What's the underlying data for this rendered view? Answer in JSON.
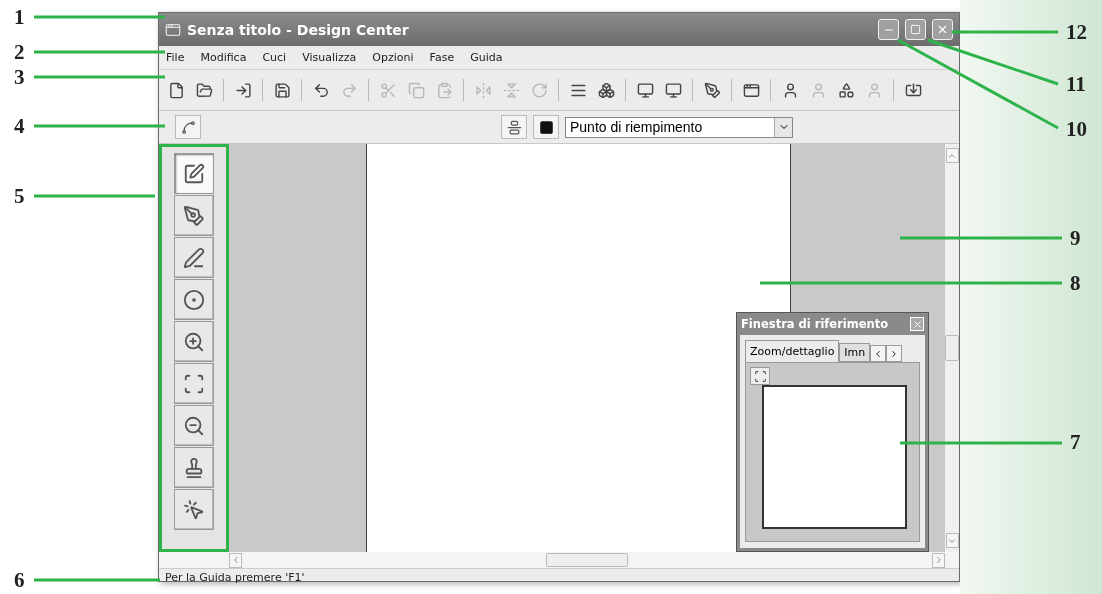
{
  "window": {
    "title": "Senza titolo - Design Center"
  },
  "menu": [
    "File",
    "Modifica",
    "Cuci",
    "Visualizza",
    "Opzioni",
    "Fase",
    "Guida"
  ],
  "toolbar": [
    {
      "disabled": false
    },
    {
      "disabled": false
    },
    {
      "disabled": false
    },
    {
      "disabled": false
    },
    {
      "disabled": false
    },
    {
      "disabled": true
    },
    {
      "disabled": true
    },
    {
      "disabled": true
    },
    {
      "disabled": true
    },
    {
      "disabled": true
    },
    {
      "disabled": true
    },
    {
      "disabled": true
    },
    {
      "disabled": false
    },
    {
      "disabled": false
    },
    {
      "disabled": false
    },
    {
      "disabled": false
    },
    {
      "disabled": false
    },
    {
      "disabled": false
    },
    {
      "disabled": false
    },
    {
      "disabled": true
    },
    {
      "disabled": false
    },
    {
      "disabled": true
    },
    {
      "disabled": false
    }
  ],
  "stitch_bar": {
    "stitch_type": "Punto di riempimento"
  },
  "tools": [
    {
      "selected": true
    },
    {
      "selected": false
    },
    {
      "selected": false
    },
    {
      "selected": false
    },
    {
      "selected": false
    },
    {
      "selected": false
    },
    {
      "selected": false
    },
    {
      "selected": false
    },
    {
      "selected": false
    }
  ],
  "reference_window": {
    "title": "Finestra di riferimento",
    "tabs": [
      {
        "label": "Zoom/dettaglio",
        "selected": true
      },
      {
        "label": "Imn",
        "selected": false
      }
    ]
  },
  "status_bar": "Per la Guida premere 'F1'",
  "callouts": [
    {
      "label": "1"
    },
    {
      "label": "2"
    },
    {
      "label": "3"
    },
    {
      "label": "4"
    },
    {
      "label": "5"
    },
    {
      "label": "6"
    },
    {
      "label": "12"
    },
    {
      "label": "11"
    },
    {
      "label": "10"
    },
    {
      "label": "9"
    },
    {
      "label": "8"
    },
    {
      "label": "7"
    }
  ]
}
